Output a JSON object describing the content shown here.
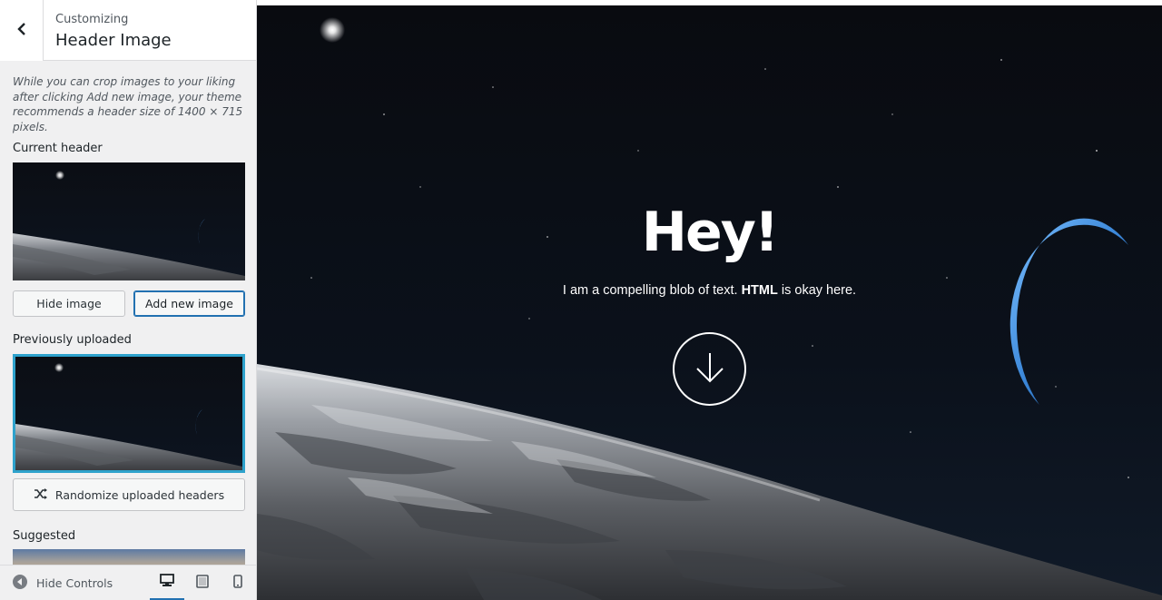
{
  "sidebar": {
    "eyebrow": "Customizing",
    "title": "Header Image",
    "description": "While you can crop images to your liking after clicking Add new image, your theme recommends a header size of 1400 × 715 pixels.",
    "current_header_label": "Current header",
    "hide_image_label": "Hide image",
    "add_new_image_label": "Add new image",
    "previously_uploaded_label": "Previously uploaded",
    "randomize_label": "Randomize uploaded headers",
    "suggested_label": "Suggested"
  },
  "footer": {
    "hide_controls_label": "Hide Controls",
    "devices": [
      "desktop-icon",
      "tablet-icon",
      "mobile-icon"
    ],
    "active_device": "desktop"
  },
  "preview": {
    "title": "Hey!",
    "text_before": "I am a compelling blob of text.",
    "text_bold": "HTML",
    "text_after": "is okay here."
  },
  "colors": {
    "accent": "#2271b1",
    "selected": "#2ea2cc",
    "sidebar_bg": "#f0f0f1"
  }
}
